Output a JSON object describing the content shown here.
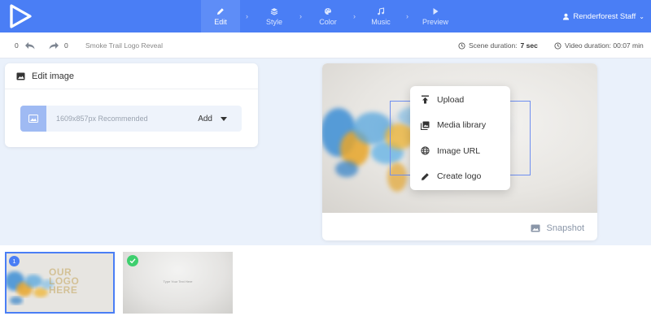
{
  "app": {
    "logo_icon": "renderforest-play-logo-icon"
  },
  "nav": {
    "steps": [
      {
        "label": "Edit",
        "icon": "pencil-icon",
        "active": true
      },
      {
        "label": "Style",
        "icon": "layers-icon",
        "active": false
      },
      {
        "label": "Color",
        "icon": "palette-icon",
        "active": false
      },
      {
        "label": "Music",
        "icon": "music-note-icon",
        "active": false
      },
      {
        "label": "Preview",
        "icon": "play-icon",
        "active": false
      }
    ],
    "user": "Renderforest Staff"
  },
  "toolbar": {
    "undo_count": "0",
    "redo_count": "0",
    "project_title": "Smoke Trail Logo Reveal",
    "scene_duration_label": "Scene duration:",
    "scene_duration_value": "7 sec",
    "video_duration_label": "Video duration: 00:07 min"
  },
  "edit_panel": {
    "title": "Edit image",
    "recommended": "1609x857px Recommended",
    "add_label": "Add"
  },
  "menu": {
    "items": [
      {
        "label": "Upload",
        "icon": "upload-icon"
      },
      {
        "label": "Media library",
        "icon": "media-library-icon"
      },
      {
        "label": "Image URL",
        "icon": "globe-icon"
      },
      {
        "label": "Create logo",
        "icon": "pencil-icon"
      }
    ]
  },
  "preview": {
    "snapshot_label": "Snapshot"
  },
  "timeline": {
    "scenes": [
      {
        "number": "1",
        "logo_text": "OUR LOGO HERE"
      },
      {
        "caption": "Type Your Text Here"
      }
    ]
  },
  "colors": {
    "brand_blue": "#4a7ef5",
    "check_green": "#3ecf6e"
  }
}
